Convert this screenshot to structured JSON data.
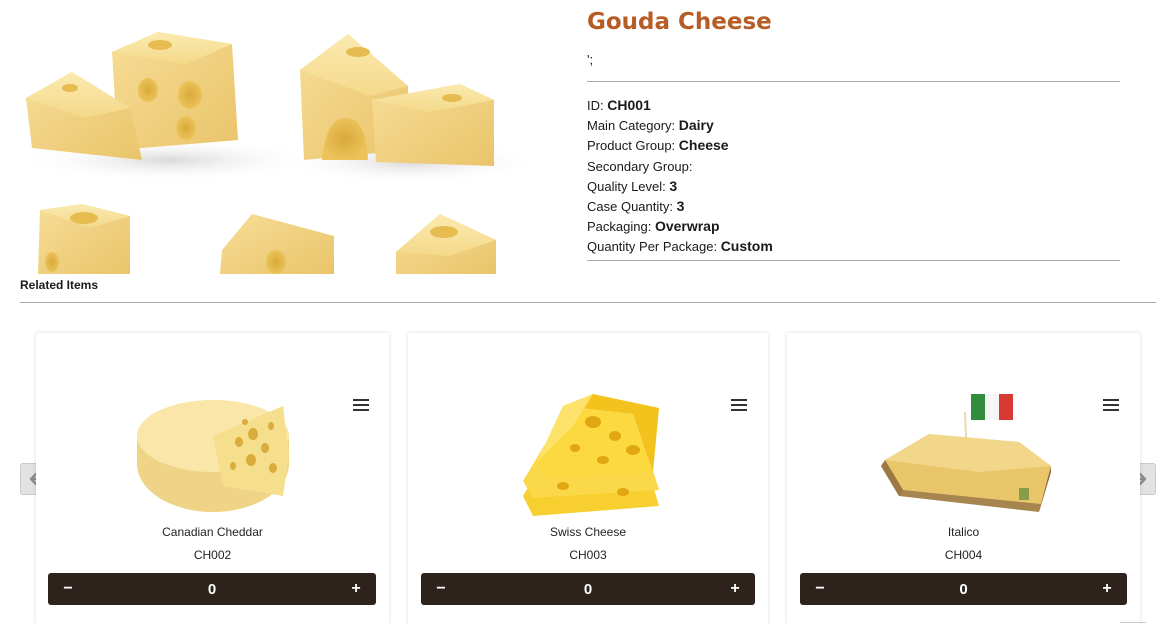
{
  "product": {
    "title": "Gouda Cheese",
    "description": "';",
    "specs": [
      {
        "label": "ID: ",
        "value": "CH001"
      },
      {
        "label": "Main Category: ",
        "value": "Dairy"
      },
      {
        "label": "Product Group: ",
        "value": "Cheese"
      },
      {
        "label": "Secondary Group: ",
        "value": ""
      },
      {
        "label": "Quality Level: ",
        "value": "3"
      },
      {
        "label": "Case Quantity: ",
        "value": "3"
      },
      {
        "label": "Packaging: ",
        "value": "Overwrap"
      },
      {
        "label": "Quantity Per Package: ",
        "value": "Custom"
      }
    ]
  },
  "related": {
    "title": "Related Items",
    "items": [
      {
        "name": "Canadian Cheddar",
        "code": "CH002",
        "quantity": "0"
      },
      {
        "name": "Swiss Cheese",
        "code": "CH003",
        "quantity": "0"
      },
      {
        "name": "Italico",
        "code": "CH004",
        "quantity": "0"
      }
    ],
    "minus_label": "−",
    "plus_label": "+"
  },
  "icons": {
    "prev": "arrow-left-icon",
    "next": "arrow-right-icon",
    "menu": "menu-icon"
  },
  "colors": {
    "title": "#b85c26",
    "qty_bar": "#2e231c",
    "cheese": "#f3d98a"
  }
}
